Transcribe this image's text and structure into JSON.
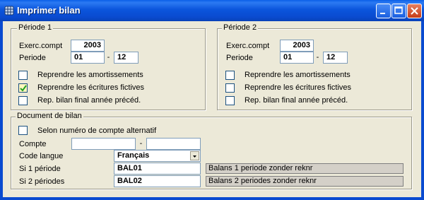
{
  "window": {
    "title": "Imprimer bilan"
  },
  "period1": {
    "legend": "Période 1",
    "exerc_label": "Exerc.compt",
    "exerc_value": "2003",
    "periode_label": "Periode",
    "periode_from": "01",
    "dash": "-",
    "periode_to": "12",
    "checkboxes": [
      {
        "label": "Reprendre les amortissements",
        "checked": false
      },
      {
        "label": "Reprendre les écritures fictives",
        "checked": true
      },
      {
        "label": "Rep. bilan final année précéd.",
        "checked": false
      }
    ]
  },
  "period2": {
    "legend": "Période 2",
    "exerc_label": "Exerc.compt",
    "exerc_value": "2003",
    "periode_label": "Periode",
    "periode_from": "01",
    "dash": "-",
    "periode_to": "12",
    "checkboxes": [
      {
        "label": "Reprendre les amortissements",
        "checked": false
      },
      {
        "label": "Reprendre les écritures fictives",
        "checked": false
      },
      {
        "label": "Rep. bilan final année précéd.",
        "checked": false
      }
    ]
  },
  "document": {
    "legend": "Document de bilan",
    "alt_account_label": "Selon numéro de compte alternatif",
    "compte_label": "Compte",
    "compte_from": "",
    "dash": "-",
    "compte_to": "",
    "langue_label": "Code langue",
    "langue_value": "Français",
    "si1_label": "Si 1 période",
    "si1_code": "BAL01",
    "si1_desc": "Balans 1 periode zonder reknr",
    "si2_label": "Si 2 périodes",
    "si2_code": "BAL02",
    "si2_desc": "Balans 2 periodes zonder reknr"
  },
  "icons": [
    "app-grid-icon",
    "minimize-icon",
    "maximize-icon",
    "close-icon",
    "checkmark-icon",
    "dropdown-arrow-icon"
  ]
}
